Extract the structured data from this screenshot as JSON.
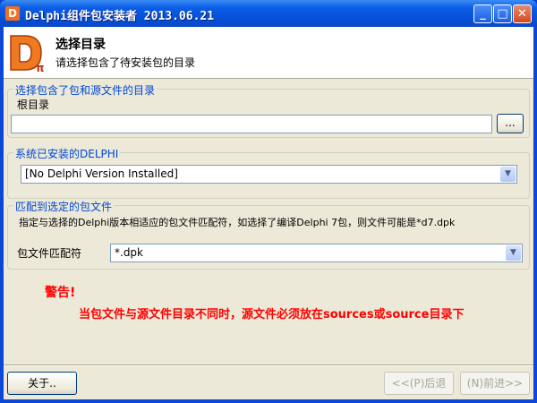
{
  "window": {
    "title": "Delphi组件包安装者 2013.06.21",
    "icon_text": "D"
  },
  "header": {
    "title": "选择目录",
    "subtitle": "请选择包含了待安装包的目录",
    "logo_text": "Dπ"
  },
  "root_group": {
    "label": "选择包含了包和源文件的目录",
    "field_label": "根目录",
    "value": "",
    "browse_label": "..."
  },
  "delphi_group": {
    "label": "系统已安装的DELPHI",
    "selected": "[No Delphi Version Installed]"
  },
  "pattern_group": {
    "label": "匹配到选定的包文件",
    "description": "指定与选择的Delphi版本相适应的包文件匹配符，如选择了编译Delphi 7包，则文件可能是*d7.dpk",
    "field_label": "包文件匹配符",
    "value": "*.dpk"
  },
  "warning": {
    "title": "警告!",
    "text": "当包文件与源文件目录不同时，源文件必须放在sources或source目录下"
  },
  "buttons": {
    "about": "关于..",
    "back": "<<(P)后退",
    "next": "(N)前进>>"
  }
}
